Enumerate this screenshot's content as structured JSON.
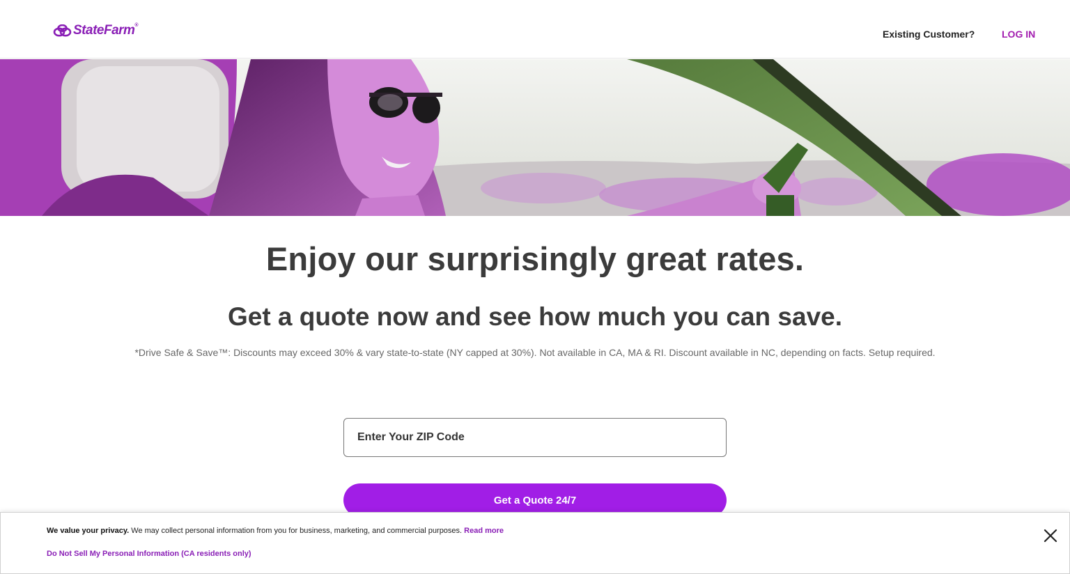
{
  "header": {
    "logo_text": "StateFarm",
    "logo_mark": "®",
    "existing_customer": "Existing Customer?",
    "login_label": "LOG IN"
  },
  "hero": {
    "image": "woman-driving-car-photo",
    "colors": {
      "primary": "#b53fc8",
      "accent": "#6a9a4a"
    }
  },
  "main": {
    "headline": "Enjoy our surprisingly great rates.",
    "subheadline": "Get a quote now and see how much you can save.",
    "disclaimer": "*Drive Safe & Save™: Discounts may exceed 30% & vary state-to-state (NY capped at 30%). Not available in CA, MA & RI. Discount available in NC, depending on facts. Setup required."
  },
  "form": {
    "zip_placeholder": "Enter Your ZIP Code",
    "zip_value": "",
    "quote_button": "Get a Quote 24/7"
  },
  "privacy": {
    "bold": "We value your privacy.",
    "text": "We may collect personal information from you for business, marketing, and commercial purposes.",
    "read_more": "Read more",
    "do_not_sell": "Do Not Sell My Personal Information (CA residents only)",
    "close_icon": "close-icon"
  },
  "colors": {
    "brand": "#8a1fb6",
    "button": "#a11ee6",
    "heading": "#3b3b3b"
  }
}
